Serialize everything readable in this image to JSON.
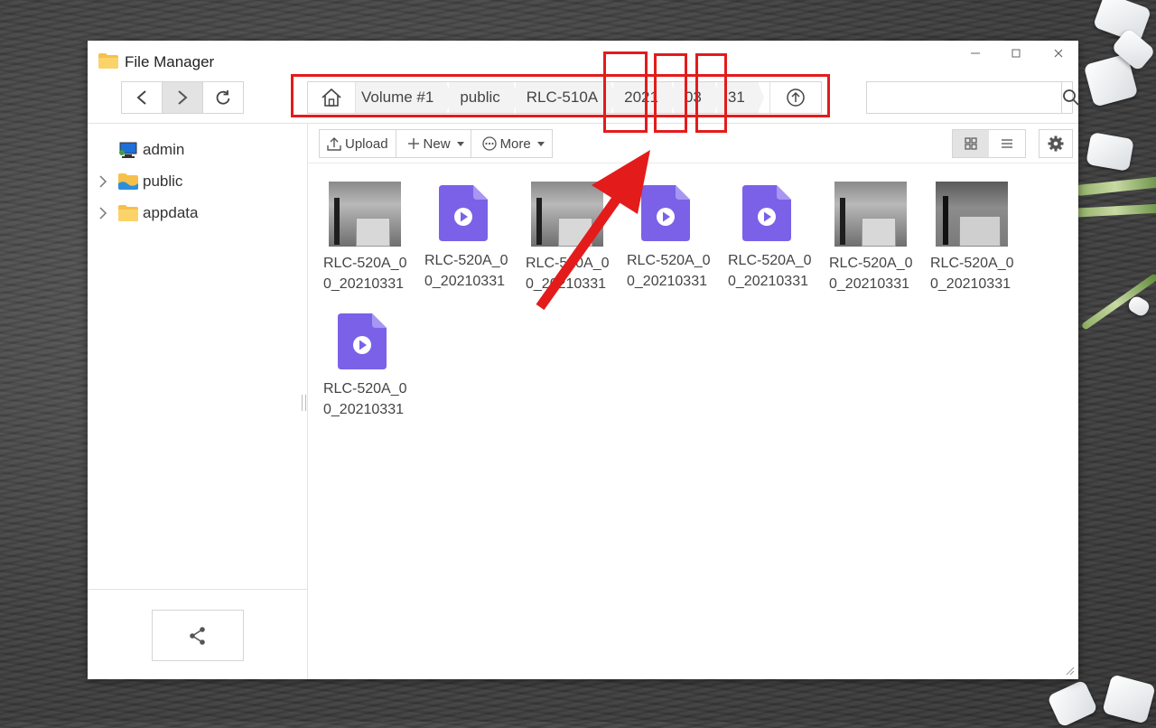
{
  "window": {
    "title": "File Manager"
  },
  "window_controls": {
    "minimize": "—",
    "maximize": "☐",
    "close": "✕"
  },
  "path": {
    "segments": [
      "Volume #1",
      "public",
      "RLC-510A",
      "2021",
      "03",
      "31"
    ]
  },
  "search": {
    "value": "",
    "placeholder": ""
  },
  "sidebar": {
    "items": [
      {
        "label": "admin",
        "icon": "user-computer-icon",
        "expandable": false
      },
      {
        "label": "public",
        "icon": "shared-folder-icon",
        "expandable": true
      },
      {
        "label": "appdata",
        "icon": "folder-icon",
        "expandable": true
      }
    ]
  },
  "toolbar": {
    "upload_label": "Upload",
    "new_label": "New",
    "more_label": "More"
  },
  "view": {
    "mode": "grid"
  },
  "files": [
    {
      "name_line1": "RLC-520A_0",
      "name_line2": "0_20210331",
      "kind": "image"
    },
    {
      "name_line1": "RLC-520A_0",
      "name_line2": "0_20210331",
      "kind": "video"
    },
    {
      "name_line1": "RLC-520A_0",
      "name_line2": "0_20210331",
      "kind": "image"
    },
    {
      "name_line1": "RLC-520A_0",
      "name_line2": "0_20210331",
      "kind": "video"
    },
    {
      "name_line1": "RLC-520A_0",
      "name_line2": "0_20210331",
      "kind": "video"
    },
    {
      "name_line1": "RLC-520A_0",
      "name_line2": "0_20210331",
      "kind": "image"
    },
    {
      "name_line1": "RLC-520A_0",
      "name_line2": "0_20210331",
      "kind": "image"
    },
    {
      "name_line1": "RLC-520A_0",
      "name_line2": "0_20210331",
      "kind": "video"
    }
  ],
  "colors": {
    "annotation": "#e41b1b",
    "video_icon": "#7b61e8",
    "folder": "#f7c04a"
  }
}
